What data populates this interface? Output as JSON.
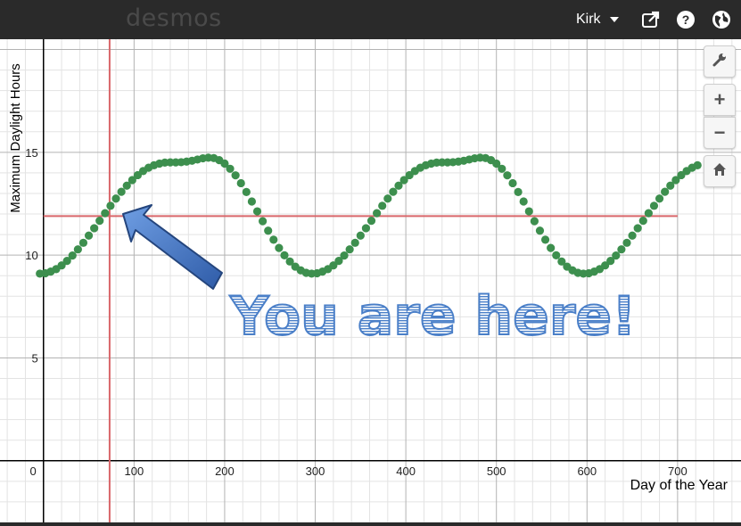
{
  "app": {
    "logo": "desmos"
  },
  "header": {
    "user_name": "Kirk"
  },
  "icons": {
    "share": "share-icon",
    "help": "help-icon",
    "language": "globe-icon",
    "settings": "wrench-icon",
    "zoom_in": "plus-icon",
    "zoom_out": "minus-icon",
    "home": "home-icon"
  },
  "annotation": {
    "text": "You are here!",
    "color": "#4a7fc8"
  },
  "colors": {
    "points": "#3d8f4e",
    "marker_lines": "#d9666a",
    "arrow": "#3f6fbf"
  },
  "chart_data": {
    "type": "scatter",
    "xlabel": "Day of the Year",
    "ylabel": "Maximum Daylight Hours",
    "x_ticks": [
      0,
      100,
      200,
      300,
      400,
      500,
      600,
      700
    ],
    "y_ticks": [
      5,
      10,
      15
    ],
    "x_tick_labels": [
      "0",
      "100",
      "200",
      "300",
      "400",
      "500",
      "600",
      "700"
    ],
    "y_tick_labels": [
      "5",
      "10",
      "15"
    ],
    "xlim": [
      -48,
      770
    ],
    "ylim": [
      -3,
      20.5
    ],
    "grid": true,
    "series": [
      {
        "x": [
          -4,
          2,
          8,
          14,
          20,
          26,
          32,
          38,
          44,
          50,
          56,
          62,
          68,
          74,
          80,
          86,
          92,
          98,
          104,
          110,
          116,
          122,
          128,
          134,
          140,
          146,
          152,
          158,
          164,
          170,
          176,
          182,
          188,
          194,
          200,
          206,
          212,
          218,
          224,
          230,
          236,
          242,
          248,
          254,
          260,
          266,
          272,
          278,
          284,
          290,
          296,
          302,
          308,
          314,
          320,
          326,
          332,
          338,
          344,
          350,
          356,
          362,
          368,
          374,
          380,
          386,
          392,
          398,
          404,
          410,
          416,
          422,
          428,
          434,
          440,
          446,
          452,
          458,
          464,
          470,
          476,
          482,
          488,
          494,
          500,
          506,
          512,
          518,
          524,
          530,
          536,
          542,
          548,
          554,
          560,
          566,
          572,
          578,
          584,
          590,
          596,
          602,
          608,
          614,
          620,
          626,
          632,
          638,
          644,
          650,
          656,
          662,
          668,
          674,
          680,
          686,
          692,
          698,
          704,
          710,
          716,
          722
        ],
        "y": [
          9.1,
          9.12,
          9.2,
          9.32,
          9.5,
          9.72,
          9.98,
          10.28,
          10.6,
          10.95,
          11.31,
          11.67,
          12.04,
          12.4,
          12.75,
          13.08,
          13.38,
          13.65,
          13.89,
          14.09,
          14.25,
          14.37,
          14.45,
          14.5,
          14.51,
          14.51,
          14.52,
          14.55,
          14.59,
          14.65,
          14.71,
          14.74,
          14.72,
          14.62,
          14.45,
          14.2,
          13.88,
          13.5,
          13.07,
          12.61,
          12.13,
          11.65,
          11.19,
          10.75,
          10.35,
          9.99,
          9.69,
          9.44,
          9.26,
          9.14,
          9.1,
          9.12,
          9.2,
          9.32,
          9.5,
          9.72,
          9.98,
          10.28,
          10.6,
          10.95,
          11.31,
          11.67,
          12.04,
          12.4,
          12.75,
          13.08,
          13.38,
          13.65,
          13.89,
          14.09,
          14.25,
          14.37,
          14.45,
          14.5,
          14.51,
          14.51,
          14.52,
          14.55,
          14.59,
          14.65,
          14.71,
          14.74,
          14.72,
          14.62,
          14.45,
          14.2,
          13.88,
          13.5,
          13.07,
          12.61,
          12.13,
          11.65,
          11.19,
          10.75,
          10.35,
          9.99,
          9.69,
          9.44,
          9.26,
          9.14,
          9.1,
          9.12,
          9.2,
          9.32,
          9.5,
          9.72,
          9.98,
          10.28,
          10.6,
          10.95,
          11.31,
          11.67,
          12.04,
          12.4,
          12.75,
          13.08,
          13.38,
          13.65,
          13.89,
          14.09,
          14.25,
          14.37
        ]
      }
    ],
    "vertical_line_x": 73,
    "horizontal_line": {
      "y": 11.9,
      "x_from": 0,
      "x_to": 700
    }
  }
}
